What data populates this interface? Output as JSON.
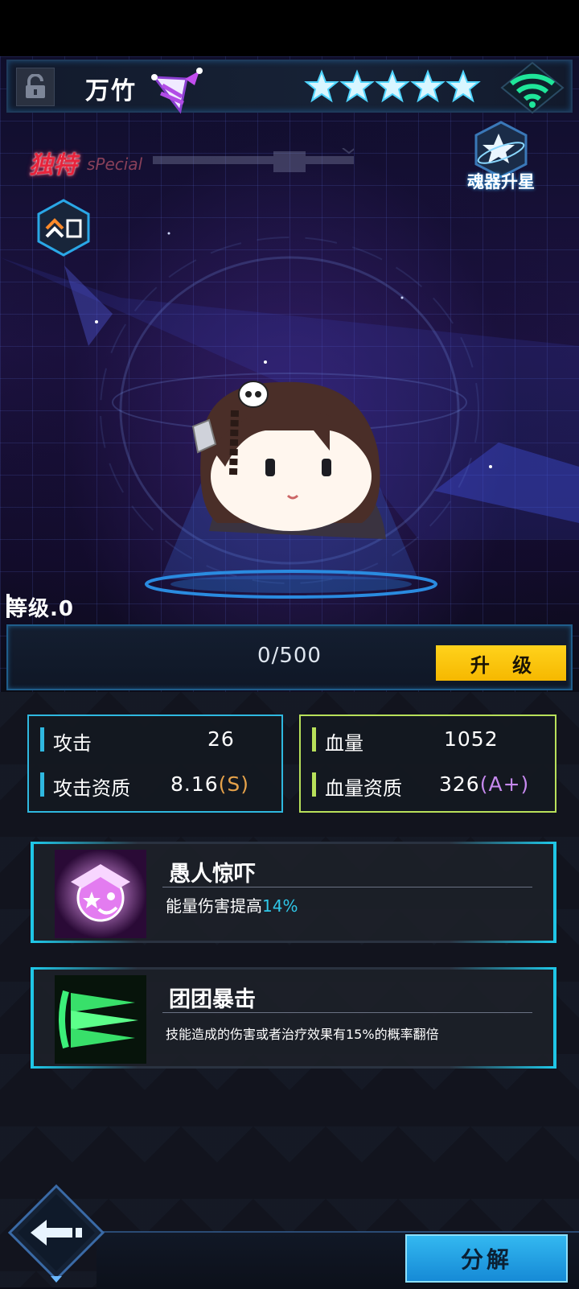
{
  "header": {
    "character_name": "万竹",
    "star_count": 5,
    "icons": [
      "unlock-icon",
      "jester-hat-icon",
      "star-icon",
      "wifi-icon"
    ]
  },
  "tags": {
    "unique": "独特",
    "special": "sPecial"
  },
  "star_up": {
    "label": "魂器升星",
    "icon": "star-orbit-icon"
  },
  "rank_badge": {
    "icon": "double-chevron-up-icon"
  },
  "level": {
    "label": "等级.0",
    "exp_text": "0/500",
    "exp_progress": 0,
    "upgrade_label": "升 级"
  },
  "stats": {
    "attack": {
      "label": "攻击",
      "value": "26"
    },
    "attack_aptitude": {
      "label": "攻击资质",
      "value": "8.16",
      "grade": "(S)"
    },
    "hp": {
      "label": "血量",
      "value": "1052"
    },
    "hp_aptitude": {
      "label": "血量资质",
      "value": "326",
      "grade": "(A+)"
    }
  },
  "skills": [
    {
      "name": "愚人惊吓",
      "desc_prefix": "能量伤害提高",
      "desc_highlight": "14%",
      "desc_suffix": "",
      "icon": "jester-face-icon"
    },
    {
      "name": "团团暴击",
      "desc_prefix": "技能造成的伤害或者治疗效果有15%的概率翻倍",
      "desc_highlight": "",
      "desc_suffix": "",
      "icon": "green-spikes-icon"
    }
  ],
  "footer": {
    "decompose_label": "分解",
    "back_icon": "back-arrow-icon"
  },
  "colors": {
    "accent_cyan": "#1fc6e6",
    "attack_border": "#2fb8e0",
    "hp_border": "#b8e05a",
    "upgrade_yellow": "#ffd21c",
    "unique_red": "#e8243c",
    "decompose_blue": "#33b8f0"
  }
}
